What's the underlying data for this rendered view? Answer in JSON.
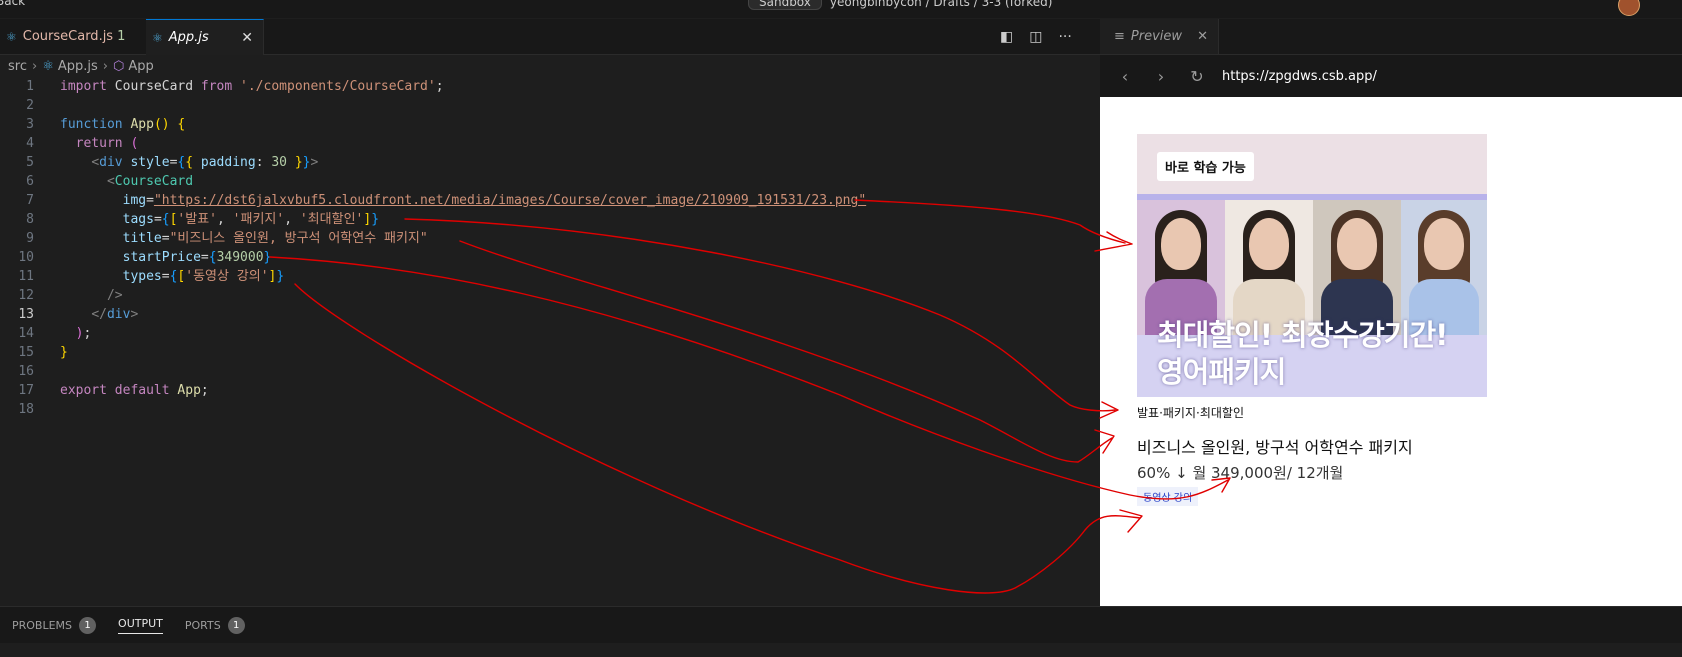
{
  "topbar": {
    "back_label": "Back",
    "sandbox_label": "Sandbox",
    "path": "yeongbinbycon / Drafts / 3-3 (forked)"
  },
  "tabs": [
    {
      "label": "CourseCard.js",
      "badge": "1"
    },
    {
      "label": "App.js"
    }
  ],
  "editor_actions": {
    "toggle_panel": "◧",
    "split": "◫",
    "more": "···"
  },
  "preview_tab": {
    "label": "Preview"
  },
  "breadcrumb": {
    "src": "src",
    "file": "App.js",
    "symbol": "App"
  },
  "code": {
    "line1": {
      "kw": "import",
      "name": " CourseCard ",
      "from": "from",
      "str": "'./components/CourseCard'",
      "end": ";"
    },
    "line3": {
      "kw": "function",
      "name": "App",
      "paren": "()",
      "brace": "{"
    },
    "line4": {
      "kw": "return",
      "paren": "("
    },
    "line5": {
      "open": "<",
      "tag": "div",
      "attr": "style",
      "eq": "=",
      "b1": "{",
      "b2": "{",
      "key": "padding",
      "colon": ":",
      "num": "30",
      "b3": "}",
      "b4": "}",
      "close": ">"
    },
    "line6": {
      "open": "<",
      "comp": "CourseCard"
    },
    "line7": {
      "attr": "img",
      "eq": "=",
      "url": "\"https://dst6jalxvbuf5.cloudfront.net/media/images/Course/cover_image/210909_191531/23.png\""
    },
    "line8": {
      "attr": "tags",
      "eq": "=",
      "b1": "{",
      "b2": "[",
      "v1": "'발표'",
      "c1": ", ",
      "v2": "'패키지'",
      "c2": ", ",
      "v3": "'최대할인'",
      "b3": "]",
      "b4": "}"
    },
    "line9": {
      "attr": "title",
      "eq": "=",
      "str": "\"비즈니스 올인원, 방구석 어학연수 패키지\""
    },
    "line10": {
      "attr": "startPrice",
      "eq": "=",
      "b1": "{",
      "num": "349000",
      "b2": "}"
    },
    "line11": {
      "attr": "types",
      "eq": "=",
      "b1": "{",
      "b2": "[",
      "v1": "'동영상 강의'",
      "b3": "]",
      "b4": "}"
    },
    "line12": {
      "text": "/>"
    },
    "line13": {
      "open": "</",
      "tag": "div",
      "close": ">"
    },
    "line14": {
      "paren": ")",
      "semi": ";"
    },
    "line15": {
      "brace": "}"
    },
    "line17": {
      "kw1": "export",
      "kw2": "default",
      "name": "App",
      "semi": ";"
    }
  },
  "line_numbers": [
    "1",
    "2",
    "3",
    "4",
    "5",
    "6",
    "7",
    "8",
    "9",
    "10",
    "11",
    "12",
    "13",
    "14",
    "15",
    "16",
    "17",
    "18"
  ],
  "browser": {
    "back": "‹",
    "forward": "›",
    "reload": "↻",
    "url": "https://zpgdws.csb.app/"
  },
  "card": {
    "image_badge": "바로 학습 가능",
    "image_headline1": "최대할인! 최장수강기간!",
    "image_headline2": "영어패키지",
    "tags": "발표·패키지·최대할인",
    "title": "비즈니스 올인원, 방구석 어학연수 패키지",
    "price": "60% ↓ 월 349,000원/ 12개월",
    "type_badge": "동영상 강의"
  },
  "panel": {
    "problems_label": "PROBLEMS",
    "problems_count": "1",
    "output_label": "OUTPUT",
    "ports_label": "PORTS",
    "ports_count": "1"
  },
  "colors": {
    "accent": "#0078d4",
    "annotation": "#e00000",
    "editor_bg": "#1e1e1e",
    "preview_bg": "#ffffff"
  }
}
